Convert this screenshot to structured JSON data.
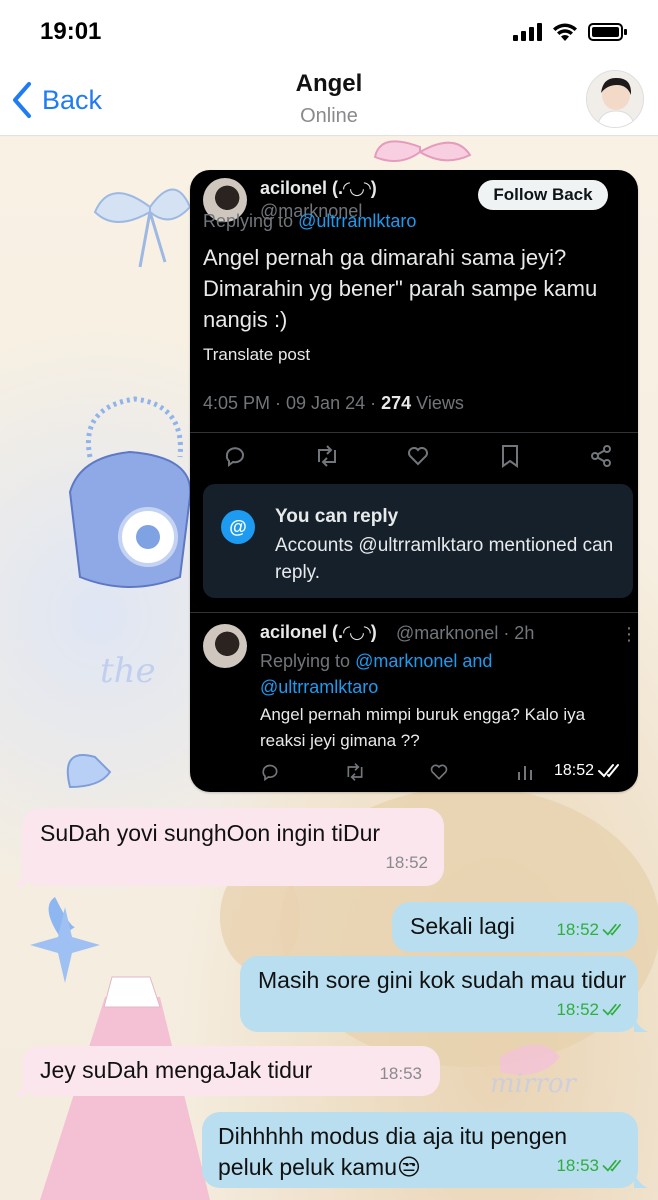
{
  "status_bar": {
    "time": "19:01"
  },
  "header": {
    "back_label": "Back",
    "title": "Angel",
    "status": "Online"
  },
  "screenshot": {
    "tweet": {
      "name": "acilonel (.◜◡◝)",
      "handle": "@marknonel",
      "follow_label": "Follow Back",
      "replying_prefix": "Replying to",
      "replying_to": "@ultrramlktaro",
      "text": "Angel pernah ga dimarahi sama jeyi? Dimarahin yg bener\" parah sampe kamu nangis :)",
      "translate": "Translate post",
      "meta_time": "4:05 PM · 09 Jan 24 ·",
      "views_count": "274",
      "views_label": "Views"
    },
    "reply_restriction": {
      "icon": "@",
      "title": "You can reply",
      "desc": "Accounts @ultrramlktaro mentioned can reply."
    },
    "second_tweet": {
      "name": "acilonel (.◜◡◝)",
      "handle": "@marknonel · 2h",
      "replying_prefix": "Replying to",
      "replying_to": "@marknonel and @ultrramlktaro",
      "text": "Angel pernah mimpi buruk engga? Kalo iya reaksi jeyi gimana ??"
    },
    "timestamp": "18:52"
  },
  "messages": [
    {
      "direction": "in",
      "text": "SuDah yovi sunghOon ingin tiDur",
      "time": "18:52"
    },
    {
      "direction": "out",
      "text": "Sekali lagi",
      "time": "18:52"
    },
    {
      "direction": "out",
      "text": "Masih sore gini kok sudah mau tidur",
      "time": "18:52"
    },
    {
      "direction": "in",
      "text": "Jey suDah mengaJak tidur",
      "time": "18:53"
    },
    {
      "direction": "out",
      "text": "Dihhhhh modus dia aja itu pengen peluk peluk kamu😒",
      "time": "18:53"
    }
  ]
}
